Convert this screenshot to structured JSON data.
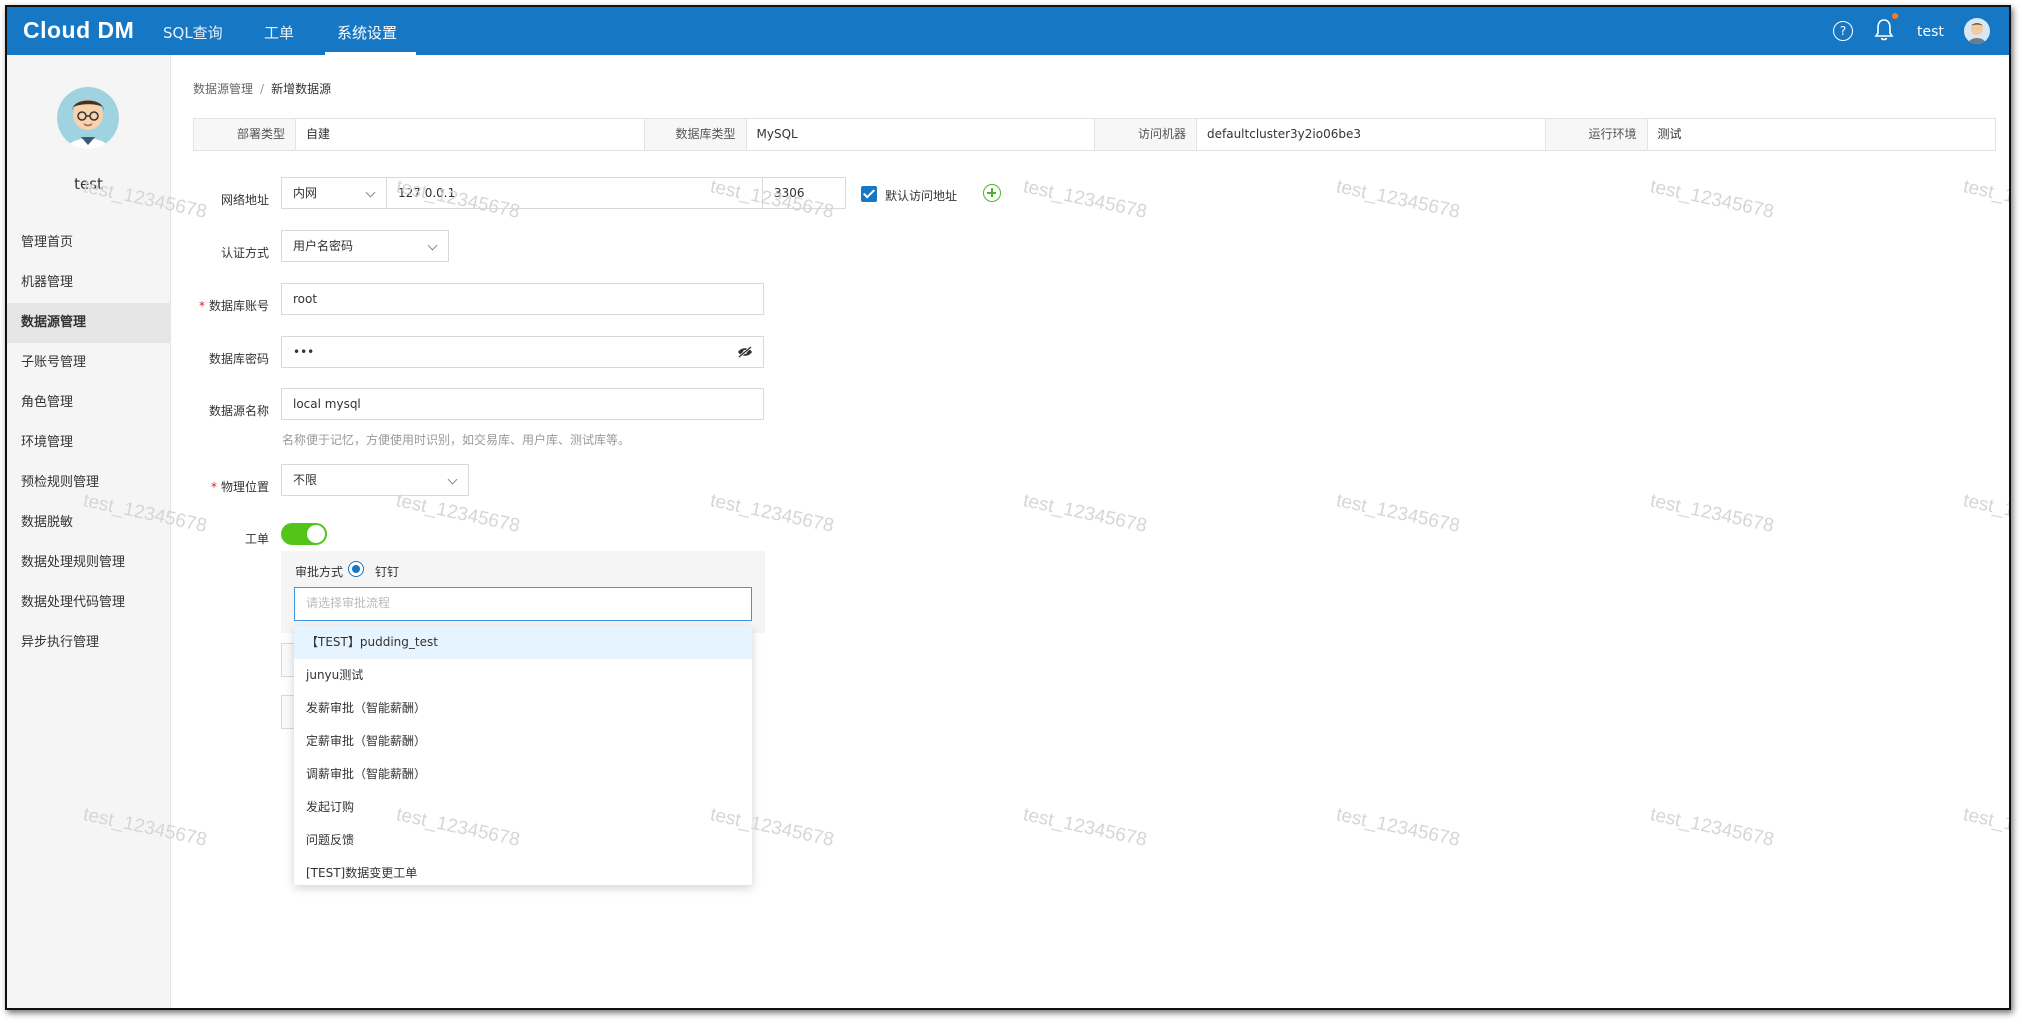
{
  "header": {
    "logo": "Cloud DM",
    "nav": [
      "SQL查询",
      "工单",
      "系统设置"
    ],
    "active_nav": "系统设置",
    "username": "test",
    "help_glyph": "?",
    "brand_color": "#1677c5"
  },
  "sidebar": {
    "username": "test",
    "items": [
      {
        "label": "管理首页"
      },
      {
        "label": "机器管理"
      },
      {
        "label": "数据源管理",
        "active": true
      },
      {
        "label": "子账号管理"
      },
      {
        "label": "角色管理"
      },
      {
        "label": "环境管理"
      },
      {
        "label": "预检规则管理"
      },
      {
        "label": "数据脱敏"
      },
      {
        "label": "数据处理规则管理"
      },
      {
        "label": "数据处理代码管理"
      },
      {
        "label": "异步执行管理"
      }
    ]
  },
  "breadcrumb": {
    "parent": "数据源管理",
    "separator": "/",
    "current": "新增数据源"
  },
  "info_bar": [
    {
      "label": "部署类型",
      "value": "自建"
    },
    {
      "label": "数据库类型",
      "value": "MySQL"
    },
    {
      "label": "访问机器",
      "value": "defaultcluster3y2io06be3"
    },
    {
      "label": "运行环境",
      "value": "测试"
    }
  ],
  "form": {
    "network": {
      "label": "网络地址",
      "type": "内网",
      "host": "127.0.0.1",
      "port": "3306",
      "default_checkbox_label": "默认访问地址",
      "default_checked": true
    },
    "auth": {
      "label": "认证方式",
      "value": "用户名密码"
    },
    "account": {
      "label": "数据库账号",
      "required": "*",
      "value": "root"
    },
    "password": {
      "label": "数据库密码",
      "value": "•••"
    },
    "datasource_name": {
      "label": "数据源名称",
      "value": "local mysql",
      "hint": "名称便于记忆，方便使用时识别，如交易库、用户库、测试库等。"
    },
    "location": {
      "label": "物理位置",
      "required": "*",
      "value": "不限"
    },
    "ticket": {
      "label": "工单",
      "enabled": true
    },
    "approval": {
      "label": "审批方式",
      "option": "钉钉",
      "flow_placeholder": "请选择审批流程"
    }
  },
  "dropdown": {
    "items": [
      "【TEST】pudding_test",
      "junyu测试",
      "发薪审批（智能薪酬）",
      "定薪审批（智能薪酬）",
      "调薪审批（智能薪酬）",
      "发起订购",
      "问题反馈",
      "[TEST]数据变更工单"
    ],
    "highlighted_index": 0
  },
  "watermark": "test_12345678",
  "icons": {
    "help": "help-icon",
    "bell": "bell-icon",
    "eye": "eye-off-icon",
    "add": "add-circle-icon",
    "chevron": "chevron-down-icon"
  }
}
